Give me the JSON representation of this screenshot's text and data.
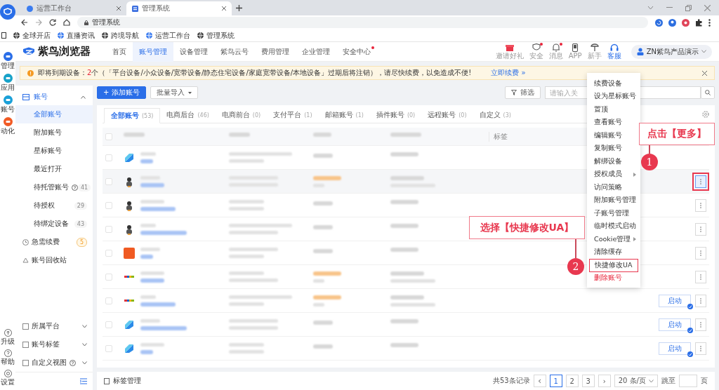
{
  "browser": {
    "tabs": [
      {
        "title": "运营工作台",
        "selected": false
      },
      {
        "title": "管理系统",
        "selected": true
      }
    ],
    "address": "管理系统",
    "bookmarks": [
      "全球开店",
      "直播资讯",
      "跨境导航",
      "运营工作台",
      "管理系统"
    ]
  },
  "rail": {
    "top": [
      "管理",
      "应用",
      "账号",
      "动化"
    ],
    "bottom": [
      "升级",
      "帮助",
      "设置"
    ]
  },
  "header": {
    "logo": "紫鸟浏览器",
    "nav": [
      {
        "label": "首页",
        "selected": false,
        "dot": false
      },
      {
        "label": "账号管理",
        "selected": true,
        "dot": false
      },
      {
        "label": "设备管理",
        "selected": false,
        "dot": false
      },
      {
        "label": "紫鸟云号",
        "selected": false,
        "dot": false
      },
      {
        "label": "费用管理",
        "selected": false,
        "dot": false
      },
      {
        "label": "企业管理",
        "selected": false,
        "dot": false
      },
      {
        "label": "安全中心",
        "selected": false,
        "dot": true
      }
    ],
    "tools": [
      {
        "kind": "gift",
        "label": "邀请好礼",
        "dot": false,
        "selected": false
      },
      {
        "kind": "shield",
        "label": "安全",
        "dot": true,
        "selected": false
      },
      {
        "kind": "bell",
        "label": "消息",
        "dot": true,
        "selected": false
      },
      {
        "kind": "phone",
        "label": "APP",
        "dot": false,
        "selected": false
      },
      {
        "kind": "guide",
        "label": "新手",
        "dot": false,
        "selected": false
      },
      {
        "kind": "headset",
        "label": "客服",
        "dot": false,
        "selected": true
      }
    ],
    "user": "ZN紫鸟产品演示"
  },
  "notice": {
    "before": "即将到期设备：",
    "count": "2",
    "after": "个（「平台设备/小众设备/宽带设备/静态住宅设备/家庭宽带设备/本地设备」过期后将注销），请尽快续费，以免造成不便!",
    "link": "立即续费 »"
  },
  "sidebar": {
    "group": {
      "label": "账号",
      "expanded": true,
      "items": [
        {
          "label": "全部账号",
          "selected": true,
          "help": false
        },
        {
          "label": "附加账号",
          "selected": false,
          "help": false
        },
        {
          "label": "星标账号",
          "selected": false,
          "help": false
        },
        {
          "label": "最近打开",
          "selected": false,
          "help": false
        },
        {
          "label": "待托管账号",
          "selected": false,
          "help": true,
          "count": "41"
        },
        {
          "label": "待授权",
          "selected": false,
          "help": false,
          "count": "29"
        },
        {
          "label": "待绑定设备",
          "selected": false,
          "help": false,
          "count": "43"
        }
      ]
    },
    "extra": [
      {
        "kind": "renew",
        "label": "急需续费",
        "count": "5",
        "warning": true
      },
      {
        "kind": "trash",
        "label": "账号回收站"
      }
    ],
    "filters": [
      {
        "label": "所属平台",
        "help": false,
        "expanded": false
      },
      {
        "label": "账号标签",
        "help": false,
        "expanded": false
      },
      {
        "label": "自定义视图",
        "help": true,
        "expanded": false
      }
    ]
  },
  "toolbar": {
    "add": "+ 添加账号",
    "import": "批量导入",
    "filter": "筛选",
    "search_placeholder": "请输入关"
  },
  "tabs": [
    {
      "label": "全部账号",
      "count": "(53)",
      "selected": true
    },
    {
      "label": "电商后台",
      "count": "(46)",
      "selected": false
    },
    {
      "label": "电商前台",
      "count": "(0)",
      "selected": false
    },
    {
      "label": "支付平台",
      "count": "(1)",
      "selected": false
    },
    {
      "label": "邮箱账号",
      "count": "(1)",
      "selected": false
    },
    {
      "label": "插件账号",
      "count": "(0)",
      "selected": false
    },
    {
      "label": "远程账号",
      "count": "(0)",
      "selected": false
    },
    {
      "label": "自定义",
      "count": "(3)",
      "selected": false
    }
  ],
  "table": {
    "tag_column": "标签",
    "all_checked": false,
    "rows": [
      {
        "kind": "tile",
        "checked": false,
        "hover": false,
        "warning": false
      },
      {
        "kind": "avatar",
        "checked": false,
        "hover": true,
        "warning": true,
        "more": true,
        "focused": true
      },
      {
        "kind": "avatar",
        "checked": false,
        "hover": false,
        "warning": false,
        "more": true,
        "focused": false
      },
      {
        "kind": "avatar",
        "checked": false,
        "hover": false,
        "warning": false,
        "more": true,
        "focused": false
      },
      {
        "kind": "orange",
        "checked": false,
        "hover": false,
        "warning": false,
        "more": true,
        "focused": false
      },
      {
        "kind": "stripe",
        "checked": false,
        "hover": false,
        "warning": true,
        "more": true,
        "focused": false
      },
      {
        "kind": "stripe",
        "checked": false,
        "hover": false,
        "warning": true,
        "start": "启动",
        "more": true,
        "focused": false
      },
      {
        "kind": "tile",
        "checked": false,
        "hover": false,
        "warning": false,
        "start": "启动",
        "more": true,
        "focused": false
      },
      {
        "kind": "tile",
        "checked": false,
        "hover": false,
        "warning": false,
        "start": "启动",
        "more": true,
        "focused": false
      }
    ]
  },
  "menu": [
    {
      "label": "续费设备",
      "kind": "normal",
      "sub": false,
      "highlighted": false
    },
    {
      "label": "设为星标账号",
      "kind": "normal",
      "sub": false,
      "highlighted": false
    },
    {
      "label": "置顶",
      "kind": "normal",
      "sub": false,
      "highlighted": false
    },
    {
      "label": "查看账号",
      "kind": "normal",
      "sub": false,
      "highlighted": false
    },
    {
      "label": "编辑账号",
      "kind": "normal",
      "sub": false,
      "highlighted": false
    },
    {
      "label": "复制账号",
      "kind": "normal",
      "sub": false,
      "highlighted": false
    },
    {
      "label": "解绑设备",
      "kind": "normal",
      "sub": false,
      "highlighted": false
    },
    {
      "label": "授权成员",
      "kind": "normal",
      "sub": true,
      "highlighted": false
    },
    {
      "label": "访问策略",
      "kind": "normal",
      "sub": false,
      "highlighted": false
    },
    {
      "label": "附加账号管理",
      "kind": "normal",
      "sub": false,
      "highlighted": false
    },
    {
      "label": "子账号管理",
      "kind": "normal",
      "sub": false,
      "highlighted": false
    },
    {
      "label": "临时模式启动",
      "kind": "normal",
      "sub": false,
      "highlighted": false
    },
    {
      "label": "Cookie管理",
      "kind": "normal",
      "sub": true,
      "highlighted": false
    },
    {
      "label": "清除缓存",
      "kind": "normal",
      "sub": false,
      "highlighted": false
    },
    {
      "label": "快捷修改UA",
      "kind": "normal",
      "sub": false,
      "highlighted": true
    },
    {
      "label": "删除账号",
      "kind": "danger",
      "sub": false,
      "highlighted": false
    }
  ],
  "annotations": [
    {
      "step": "1",
      "text": "点击【更多】"
    },
    {
      "step": "2",
      "text": "选择【快捷修改UA】"
    }
  ],
  "footer": {
    "tag_manage": "标签管理",
    "total": "共53条记录",
    "prev": "‹",
    "pages": [
      {
        "label": "1",
        "selected": true
      },
      {
        "label": "2",
        "selected": false
      },
      {
        "label": "3",
        "selected": false
      }
    ],
    "next": "›",
    "page_size": "20 条/页",
    "jump": "跳至",
    "page_unit": "页"
  }
}
